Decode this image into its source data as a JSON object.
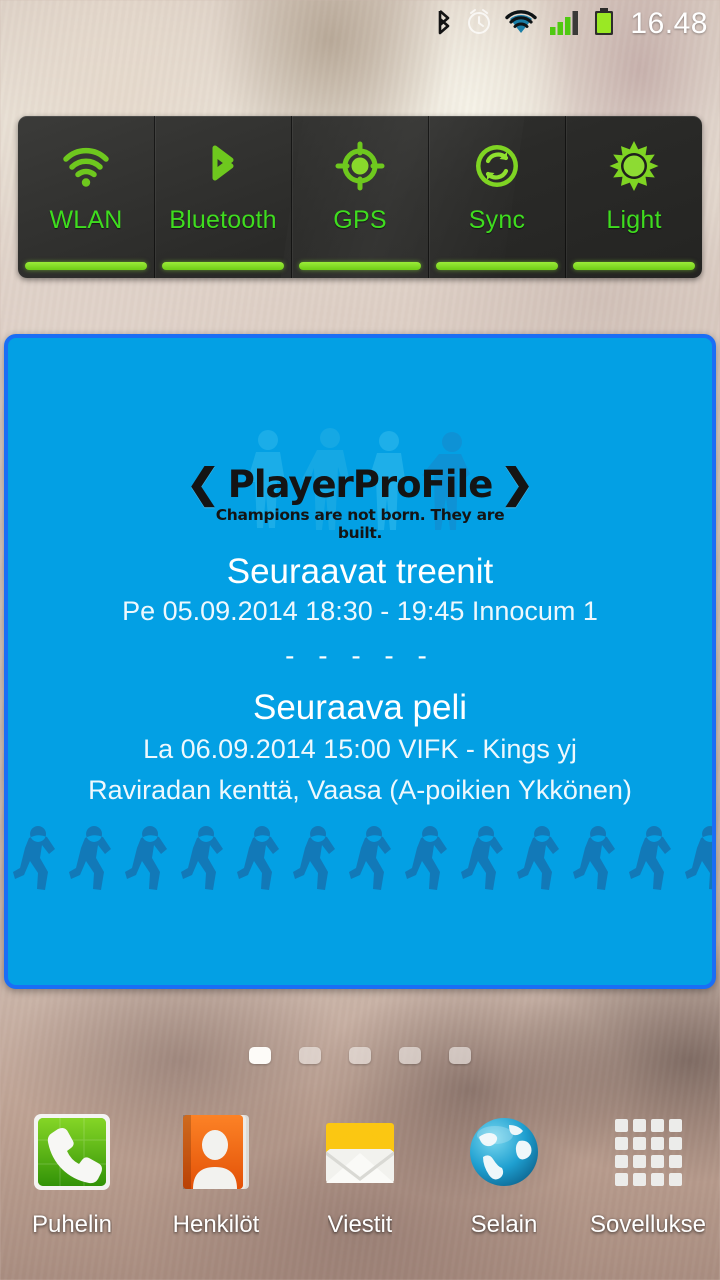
{
  "statusbar": {
    "icons": [
      "bluetooth-icon",
      "alarm-clock-icon",
      "wifi-icon",
      "cellular-signal-icon",
      "battery-icon"
    ],
    "clock": "16.48",
    "clock_color": "#ffffff"
  },
  "toggles": {
    "accent_color": "#3fdc1f",
    "bar_color": "#7ddd2a",
    "items": [
      {
        "label": "WLAN",
        "icon": "wifi-icon",
        "state": "on"
      },
      {
        "label": "Bluetooth",
        "icon": "bluetooth-icon",
        "state": "on"
      },
      {
        "label": "GPS",
        "icon": "gps-target-icon",
        "state": "on"
      },
      {
        "label": "Sync",
        "icon": "sync-icon",
        "state": "on"
      },
      {
        "label": "Light",
        "icon": "brightness-sun-icon",
        "state": "on"
      }
    ]
  },
  "widget": {
    "background_color": "#03a0e4",
    "border_color": "#1a6ef5",
    "logo": {
      "left_chevron": "❮",
      "name": "PlayerProFile",
      "right_chevron": "❯",
      "tagline": "Champions are not born. They are built."
    },
    "training": {
      "title": "Seuraavat treenit",
      "info": "Pe 05.09.2014 18:30 - 19:45 Innocum 1"
    },
    "separator": "- - - - -",
    "game": {
      "title": "Seuraava peli",
      "info": "La 06.09.2014 15:00 VIFK - Kings yj",
      "place": "Raviradan kenttä, Vaasa (A-poikien Ykkönen)"
    }
  },
  "pages": {
    "count": 5,
    "active_index": 0
  },
  "dock": {
    "items": [
      {
        "label": "Puhelin",
        "icon": "phone-icon"
      },
      {
        "label": "Henkilöt",
        "icon": "contacts-icon"
      },
      {
        "label": "Viestit",
        "icon": "messages-envelope-icon"
      },
      {
        "label": "Selain",
        "icon": "browser-globe-icon"
      },
      {
        "label": "Sovellukse",
        "icon": "app-drawer-grid-icon"
      }
    ]
  }
}
